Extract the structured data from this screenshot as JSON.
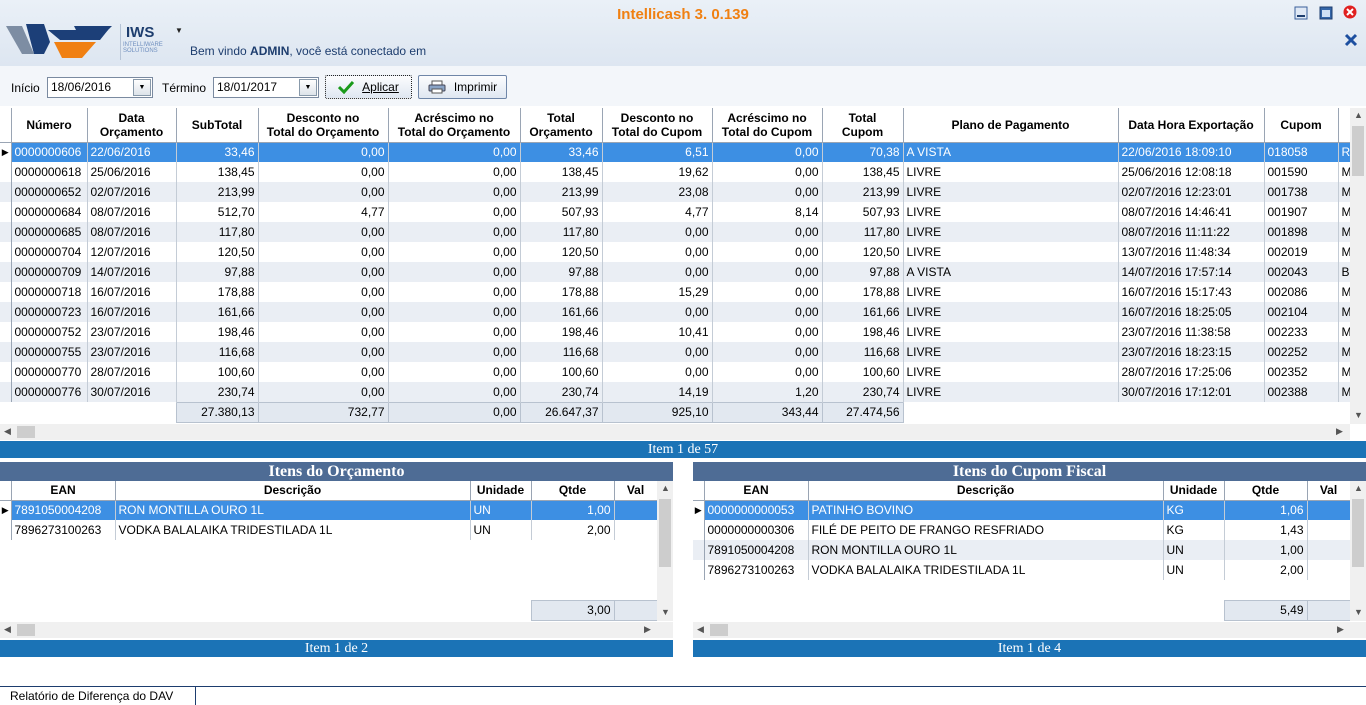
{
  "app": {
    "title": "Intellicash 3. 0.139",
    "logo_text": "IWS",
    "logo_sub": "INTELLIWARE SOLUTIONS",
    "welcome_prefix": "Bem vindo ",
    "welcome_user": "ADMIN",
    "welcome_suffix": ", você está conectado em"
  },
  "toolbar": {
    "inicio_label": "Início",
    "inicio_value": "18/06/2016",
    "termino_label": "Término",
    "termino_value": "18/01/2017",
    "apply_label": "Aplicar",
    "print_label": "Imprimir"
  },
  "main_grid": {
    "columns": [
      "Número",
      "Data\nOrçamento",
      "SubTotal",
      "Desconto no\nTotal do Orçamento",
      "Acréscimo no\nTotal do Orçamento",
      "Total\nOrçamento",
      "Desconto no\nTotal do Cupom",
      "Acréscimo no\nTotal do Cupom",
      "Total\nCupom",
      "Plano de Pagamento",
      "Data Hora Exportação",
      "Cupom",
      ""
    ],
    "rows": [
      [
        "0000000606",
        "22/06/2016",
        "33,46",
        "0,00",
        "0,00",
        "33,46",
        "6,51",
        "0,00",
        "70,38",
        "A VISTA",
        "22/06/2016 18:09:10",
        "018058",
        "R"
      ],
      [
        "0000000618",
        "25/06/2016",
        "138,45",
        "0,00",
        "0,00",
        "138,45",
        "19,62",
        "0,00",
        "138,45",
        "LIVRE",
        "25/06/2016 12:08:18",
        "001590",
        "M"
      ],
      [
        "0000000652",
        "02/07/2016",
        "213,99",
        "0,00",
        "0,00",
        "213,99",
        "23,08",
        "0,00",
        "213,99",
        "LIVRE",
        "02/07/2016 12:23:01",
        "001738",
        "M"
      ],
      [
        "0000000684",
        "08/07/2016",
        "512,70",
        "4,77",
        "0,00",
        "507,93",
        "4,77",
        "8,14",
        "507,93",
        "LIVRE",
        "08/07/2016 14:46:41",
        "001907",
        "M"
      ],
      [
        "0000000685",
        "08/07/2016",
        "117,80",
        "0,00",
        "0,00",
        "117,80",
        "0,00",
        "0,00",
        "117,80",
        "LIVRE",
        "08/07/2016 11:11:22",
        "001898",
        "M"
      ],
      [
        "0000000704",
        "12/07/2016",
        "120,50",
        "0,00",
        "0,00",
        "120,50",
        "0,00",
        "0,00",
        "120,50",
        "LIVRE",
        "13/07/2016 11:48:34",
        "002019",
        "M"
      ],
      [
        "0000000709",
        "14/07/2016",
        "97,88",
        "0,00",
        "0,00",
        "97,88",
        "0,00",
        "0,00",
        "97,88",
        "A VISTA",
        "14/07/2016 17:57:14",
        "002043",
        "B"
      ],
      [
        "0000000718",
        "16/07/2016",
        "178,88",
        "0,00",
        "0,00",
        "178,88",
        "15,29",
        "0,00",
        "178,88",
        "LIVRE",
        "16/07/2016 15:17:43",
        "002086",
        "M"
      ],
      [
        "0000000723",
        "16/07/2016",
        "161,66",
        "0,00",
        "0,00",
        "161,66",
        "0,00",
        "0,00",
        "161,66",
        "LIVRE",
        "16/07/2016 18:25:05",
        "002104",
        "M"
      ],
      [
        "0000000752",
        "23/07/2016",
        "198,46",
        "0,00",
        "0,00",
        "198,46",
        "10,41",
        "0,00",
        "198,46",
        "LIVRE",
        "23/07/2016 11:38:58",
        "002233",
        "M"
      ],
      [
        "0000000755",
        "23/07/2016",
        "116,68",
        "0,00",
        "0,00",
        "116,68",
        "0,00",
        "0,00",
        "116,68",
        "LIVRE",
        "23/07/2016 18:23:15",
        "002252",
        "M"
      ],
      [
        "0000000770",
        "28/07/2016",
        "100,60",
        "0,00",
        "0,00",
        "100,60",
        "0,00",
        "0,00",
        "100,60",
        "LIVRE",
        "28/07/2016 17:25:06",
        "002352",
        "M"
      ],
      [
        "0000000776",
        "30/07/2016",
        "230,74",
        "0,00",
        "0,00",
        "230,74",
        "14,19",
        "1,20",
        "230,74",
        "LIVRE",
        "30/07/2016 17:12:01",
        "002388",
        "M"
      ]
    ],
    "totals": [
      "27.380,13",
      "732,77",
      "0,00",
      "26.647,37",
      "925,10",
      "343,44",
      "27.474,56"
    ],
    "status": "Item 1 de 57"
  },
  "orcamento_panel": {
    "title": "Itens do Orçamento",
    "columns": [
      "EAN",
      "Descrição",
      "Unidade",
      "Qtde",
      "Val"
    ],
    "rows": [
      [
        "7891050004208",
        "RON MONTILLA OURO 1L",
        "UN",
        "1,00",
        ""
      ],
      [
        "7896273100263",
        "VODKA BALALAIKA TRIDESTILADA 1L",
        "UN",
        "2,00",
        ""
      ]
    ],
    "total_qtde": "3,00",
    "status": "Item 1 de 2"
  },
  "cupom_panel": {
    "title": "Itens do Cupom Fiscal",
    "columns": [
      "EAN",
      "Descrição",
      "Unidade",
      "Qtde",
      "Val"
    ],
    "rows": [
      [
        "0000000000053",
        "PATINHO BOVINO",
        "KG",
        "1,06",
        ""
      ],
      [
        "0000000000306",
        "FILÉ DE PEITO DE FRANGO RESFRIADO",
        "KG",
        "1,43",
        ""
      ],
      [
        "7891050004208",
        "RON MONTILLA OURO 1L",
        "UN",
        "1,00",
        ""
      ],
      [
        "7896273100263",
        "VODKA BALALAIKA TRIDESTILADA 1L",
        "UN",
        "2,00",
        ""
      ]
    ],
    "total_qtde": "5,49",
    "status": "Item 1 de 4"
  },
  "footer": {
    "tab_label": "Relatório de Diferença do DAV"
  },
  "colors": {
    "accent": "#f08012",
    "selection": "#3d8fe3",
    "status_bar": "#1b73b6",
    "panel_title": "#4e6c95"
  }
}
